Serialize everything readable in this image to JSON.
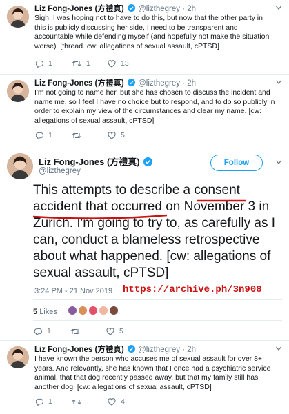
{
  "tweets": [
    {
      "name": "Liz Fong-Jones (方禮真)",
      "handle": "@lizthegrey",
      "dot": "·",
      "time": "2h",
      "text": "Sigh, I was hoping not to have to do this, but now that the other party in this is publicly discussing her side, I need to be transparent and accountable while defending myself (and hopefully not make the situation worse). [thread. cw: allegations of sexual assault, cPTSD]",
      "replies": "1",
      "retweets": "1",
      "likes": "13"
    },
    {
      "name": "Liz Fong-Jones (方禮真)",
      "handle": "@lizthegrey",
      "dot": "·",
      "time": "2h",
      "text": "I'm not going to name her, but she has chosen to discuss the incident and name me, so I feel I have no choice but to respond, and to do so publicly in order to explain my view of the circumstances and clear my name. [cw: allegations of sexual assault, cPTSD]",
      "replies": "1",
      "retweets": "",
      "likes": "5"
    }
  ],
  "main": {
    "name": "Liz Fong-Jones (方禮真)",
    "handle": "@lizthegrey",
    "follow_label": "Follow",
    "text": "This attempts to describe a consent accident that occurred on November 3 in Zurich. I'm going to try to, as carefully as I can, conduct a blameless retrospective about what happened. [cw: allegations of sexual assault, cPTSD]",
    "timestamp": "3:24 PM - 21 Nov 2019",
    "archive_url": "https://archive.ph/3n908",
    "likes_count": "5",
    "likes_label": "Likes",
    "replies": "1",
    "retweets": "",
    "likes": "5"
  },
  "last": {
    "name": "Liz Fong-Jones (方禮真)",
    "handle": "@lizthegrey",
    "dot": "·",
    "time": "2h",
    "text": "I have known the person who accuses me of sexual assault for over 8+ years. And relevantly, she has known that I once had a psychiatric service animal, that that dog recently passed away, but that my family still has another dog. [cw: allegations of sexual assault, cPTSD]",
    "replies": "1",
    "retweets": "",
    "likes": "4"
  },
  "colors": {
    "accent": "#1da1f2",
    "annotation_red": "#cc1111",
    "secondary_text": "#657786"
  },
  "icons": [
    "chevron-down-icon",
    "verified-icon",
    "reply-icon",
    "retweet-icon",
    "like-icon"
  ]
}
